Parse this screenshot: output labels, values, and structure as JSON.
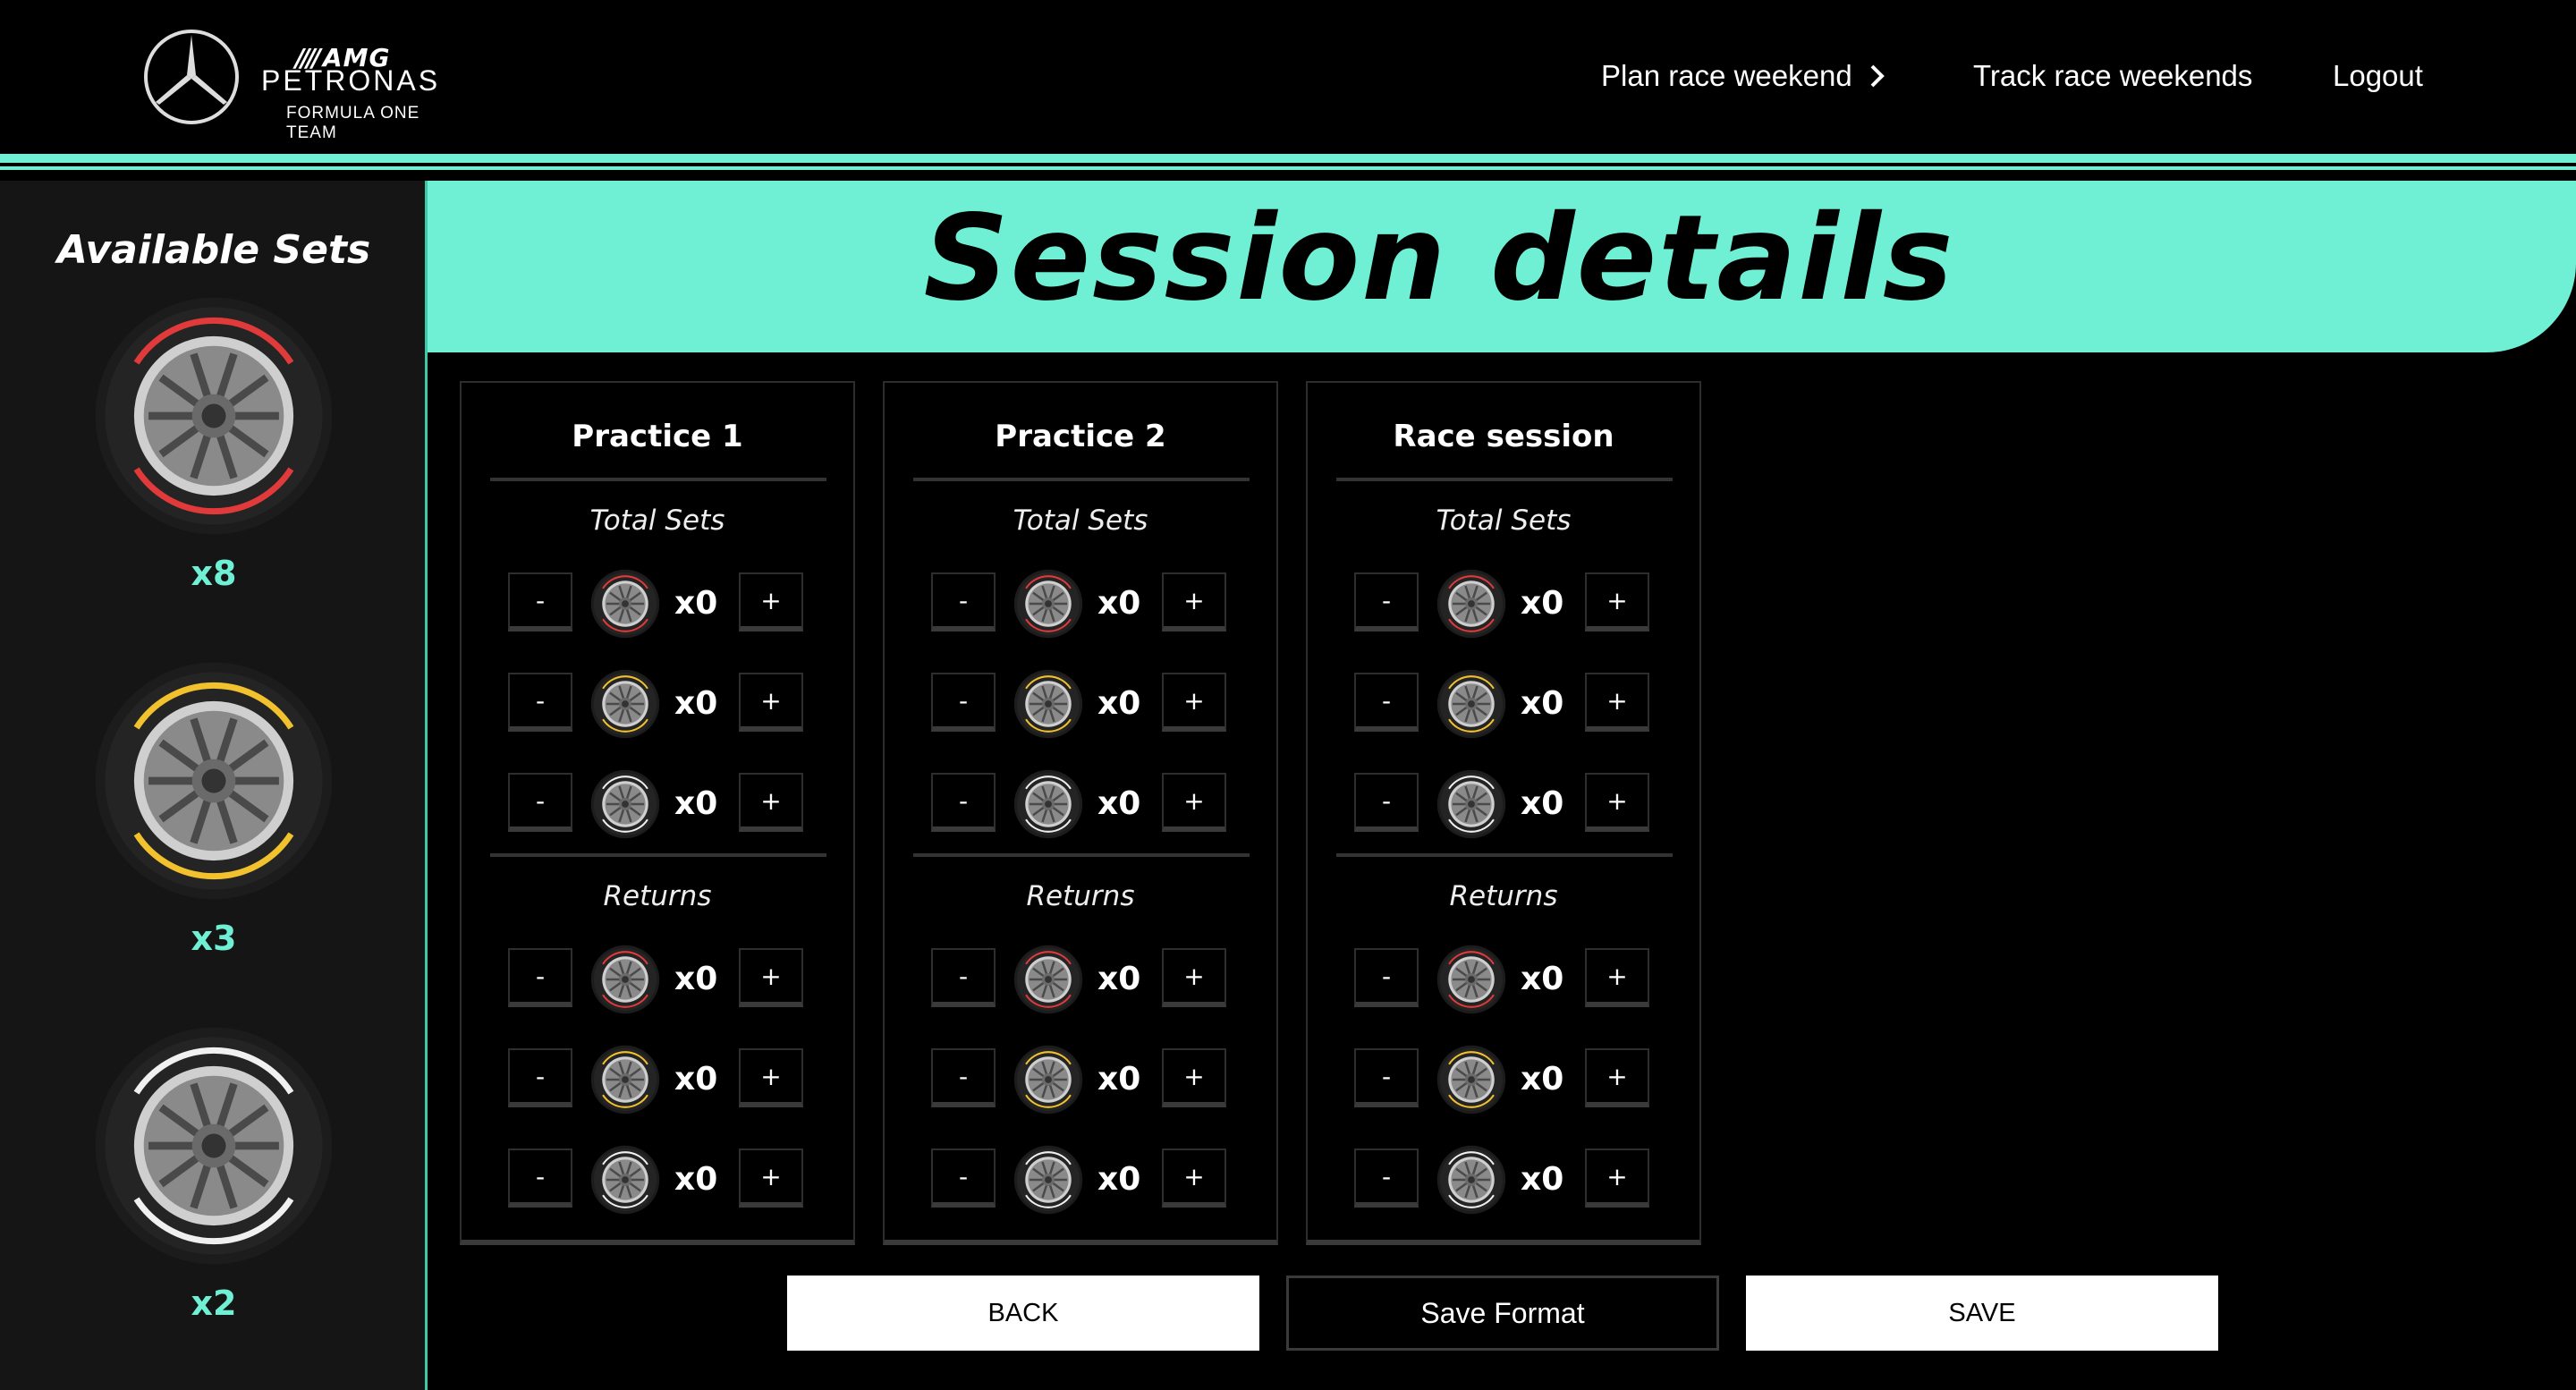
{
  "header": {
    "brand_amg": "AMG",
    "brand_petronas": "PETRONAS",
    "brand_sub": "FORMULA ONE TEAM",
    "nav": {
      "plan": "Plan race weekend",
      "track": "Track race weekends",
      "logout": "Logout"
    }
  },
  "sidebar": {
    "title": "Available Sets",
    "sets": [
      {
        "compound": "soft",
        "color": "#e03a3a",
        "count": "x8"
      },
      {
        "compound": "medium",
        "color": "#f2c12e",
        "count": "x3"
      },
      {
        "compound": "hard",
        "color": "#f0f0f0",
        "count": "x2"
      }
    ]
  },
  "banner": {
    "title": "Session details"
  },
  "sessions": [
    {
      "title": "Practice 1",
      "total_label": "Total Sets",
      "returns_label": "Returns",
      "total": [
        {
          "qty": "x0"
        },
        {
          "qty": "x0"
        },
        {
          "qty": "x0"
        }
      ],
      "returns": [
        {
          "qty": "x0"
        },
        {
          "qty": "x0"
        },
        {
          "qty": "x0"
        }
      ]
    },
    {
      "title": "Practice 2",
      "total_label": "Total Sets",
      "returns_label": "Returns",
      "total": [
        {
          "qty": "x0"
        },
        {
          "qty": "x0"
        },
        {
          "qty": "x0"
        }
      ],
      "returns": [
        {
          "qty": "x0"
        },
        {
          "qty": "x0"
        },
        {
          "qty": "x0"
        }
      ]
    },
    {
      "title": "Race session",
      "total_label": "Total Sets",
      "returns_label": "Returns",
      "total": [
        {
          "qty": "x0"
        },
        {
          "qty": "x0"
        },
        {
          "qty": "x0"
        }
      ],
      "returns": [
        {
          "qty": "x0"
        },
        {
          "qty": "x0"
        },
        {
          "qty": "x0"
        }
      ]
    }
  ],
  "buttons": {
    "minus": "-",
    "plus": "+",
    "back": "BACK",
    "save_format": "Save Format",
    "save": "SAVE"
  },
  "colors": {
    "accent": "#6ff0d4",
    "soft": "#e03a3a",
    "medium": "#f2c12e",
    "hard": "#f0f0f0"
  },
  "icons": {
    "brand": "mercedes-star-icon",
    "nav_chevron": "chevron-right-icon",
    "tyre": "tyre-icon"
  }
}
